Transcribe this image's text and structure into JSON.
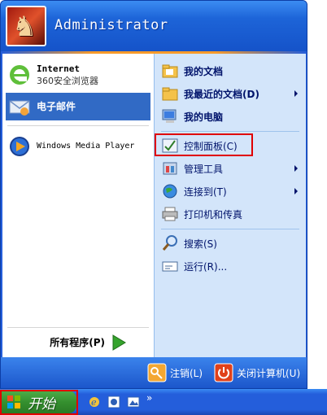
{
  "header": {
    "username": "Administrator"
  },
  "pinned": [
    {
      "title": "Internet",
      "subtitle": "360安全浏览器",
      "icon": "ie-icon"
    },
    {
      "title": "电子邮件",
      "icon": "email-icon"
    }
  ],
  "recent": [
    {
      "label": "Windows Media Player",
      "icon": "media-player-icon"
    }
  ],
  "all_programs": {
    "label": "所有程序(P)"
  },
  "right": [
    {
      "label": "我的文档",
      "icon": "my-documents-icon",
      "bold": true,
      "arrow": false
    },
    {
      "label": "我最近的文档(D)",
      "icon": "recent-documents-icon",
      "bold": true,
      "arrow": true
    },
    {
      "label": "我的电脑",
      "icon": "my-computer-icon",
      "bold": true,
      "arrow": false
    },
    {
      "label": "控制面板(C)",
      "icon": "control-panel-icon",
      "bold": false,
      "arrow": false
    },
    {
      "label": "管理工具",
      "icon": "admin-tools-icon",
      "bold": false,
      "arrow": true
    },
    {
      "label": "连接到(T)",
      "icon": "connect-to-icon",
      "bold": false,
      "arrow": true
    },
    {
      "label": "打印机和传真",
      "icon": "printer-icon",
      "bold": false,
      "arrow": false
    },
    {
      "label": "搜索(S)",
      "icon": "search-icon",
      "bold": false,
      "arrow": false
    },
    {
      "label": "运行(R)...",
      "icon": "run-icon",
      "bold": false,
      "arrow": false
    }
  ],
  "footer": {
    "logoff": "注销(L)",
    "shutdown": "关闭计算机(U)"
  },
  "taskbar": {
    "start_label": "开始",
    "overflow": "»"
  },
  "colors": {
    "highlight": "#e00000",
    "menu_blue": "#245edb",
    "selected": "#316ac5"
  }
}
